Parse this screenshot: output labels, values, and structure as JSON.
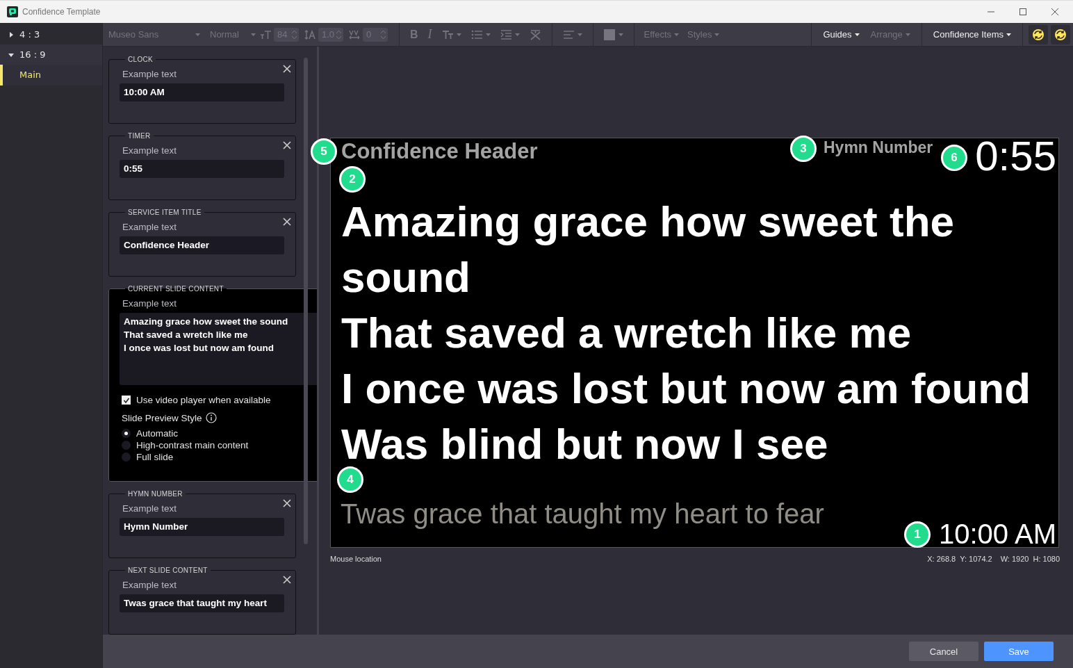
{
  "window": {
    "title": "Confidence Template"
  },
  "layouts": [
    {
      "label": "4 : 3",
      "expanded": false
    },
    {
      "label": "16 : 9",
      "expanded": true,
      "children": [
        {
          "label": "Main",
          "selected": true
        }
      ]
    }
  ],
  "toolbar": {
    "selects": [
      {
        "kind": "font",
        "value": "Museo Sans",
        "disabled": true
      },
      {
        "kind": "weight",
        "value": "Normal",
        "disabled": true
      }
    ],
    "spinners": [
      {
        "kind": "size",
        "value": "84",
        "disabled": true
      },
      {
        "kind": "line-height",
        "value": "1.0",
        "disabled": true
      },
      {
        "kind": "spacing",
        "value": "0",
        "disabled": true
      }
    ],
    "tools": [
      {
        "kind": "bold",
        "label": "B",
        "disabled": true
      },
      {
        "kind": "italic",
        "label": "I",
        "disabled": true
      },
      {
        "kind": "text-size",
        "disabled": true
      },
      {
        "kind": "list",
        "disabled": true
      },
      {
        "kind": "indent",
        "disabled": true
      },
      {
        "kind": "clear",
        "disabled": true
      },
      {
        "kind": "align",
        "disabled": true
      },
      {
        "kind": "color",
        "disabled": true
      }
    ],
    "menus": [
      {
        "label": "Effects",
        "disabled": true
      },
      {
        "label": "Styles",
        "disabled": true
      }
    ],
    "right_menus": [
      {
        "label": "Guides",
        "disabled": false
      },
      {
        "label": "Arrange",
        "disabled": true
      },
      {
        "label": "Confidence Items",
        "disabled": false
      }
    ]
  },
  "panels": [
    {
      "title": "CLOCK",
      "kind": "text",
      "label": "Example text",
      "value": "10:00 AM"
    },
    {
      "title": "TIMER",
      "kind": "text",
      "label": "Example text",
      "value": "0:55"
    },
    {
      "title": "SERVICE ITEM TITLE",
      "kind": "text",
      "label": "Example text",
      "value": "Confidence Header"
    },
    {
      "title": "CURRENT SLIDE CONTENT",
      "kind": "slide",
      "label": "Example text",
      "value": "Amazing grace how sweet the sound\nThat saved a wretch like me\nI once was lost but now am found",
      "checkbox": {
        "label": "Use video player when available",
        "checked": true
      },
      "preview_style": {
        "label": "Slide Preview Style",
        "options": [
          {
            "label": "Automatic",
            "selected": true
          },
          {
            "label": "High-contrast main content",
            "selected": false
          },
          {
            "label": "Full slide",
            "selected": false
          }
        ]
      }
    },
    {
      "title": "HYMN NUMBER",
      "kind": "text",
      "label": "Example text",
      "value": "Hymn Number"
    },
    {
      "title": "NEXT SLIDE CONTENT",
      "kind": "text",
      "label": "Example text",
      "value": "Twas grace that taught my heart"
    }
  ],
  "slide": {
    "elements": [
      {
        "kind": "header",
        "badge": "5",
        "text": "Confidence Header"
      },
      {
        "kind": "current",
        "badge": "2",
        "lines": [
          "Amazing grace how sweet the sound",
          "That saved a wretch like me",
          "I once was lost but now am found",
          "Was blind but now I see"
        ]
      },
      {
        "kind": "next",
        "badge": "4",
        "text": "Twas grace that taught my heart to fear"
      },
      {
        "kind": "clock",
        "badge": "1",
        "text": "10:00 AM"
      },
      {
        "kind": "hymn",
        "badge": "3",
        "text": "Hymn Number"
      },
      {
        "kind": "timer",
        "badge": "6",
        "text": "0:55"
      }
    ]
  },
  "status": {
    "label": "Mouse location",
    "readings": [
      "X: 268.8",
      "Y: 1074.2",
      "W: 1920",
      "H: 1080"
    ]
  },
  "buttons": [
    {
      "kind": "cancel",
      "label": "Cancel"
    },
    {
      "kind": "save",
      "label": "Save"
    }
  ]
}
